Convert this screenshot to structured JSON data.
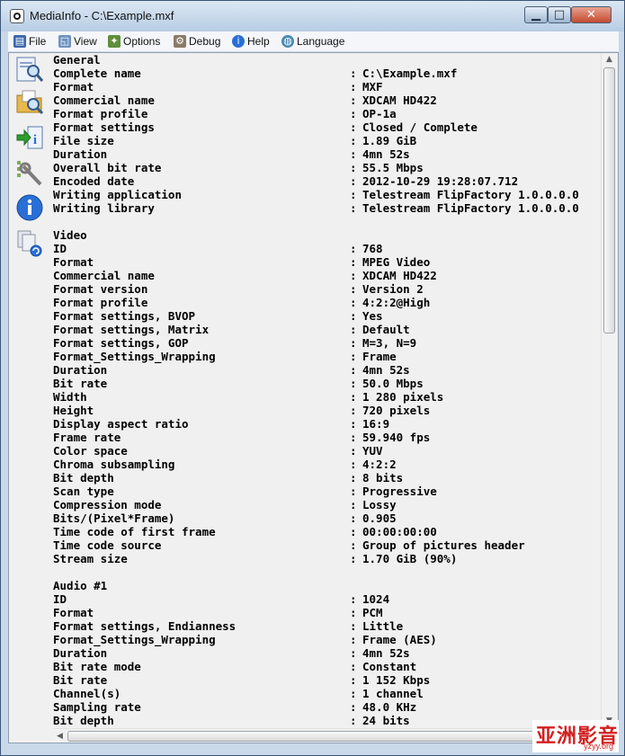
{
  "window": {
    "title": "MediaInfo - C:\\Example.mxf"
  },
  "title_buttons": {
    "minimize": "▁",
    "maximize": "□",
    "close": "✕"
  },
  "menu": [
    {
      "label": "File",
      "icon": "file-icon"
    },
    {
      "label": "View",
      "icon": "view-icon"
    },
    {
      "label": "Options",
      "icon": "options-icon"
    },
    {
      "label": "Debug",
      "icon": "debug-icon"
    },
    {
      "label": "Help",
      "icon": "help-icon"
    },
    {
      "label": "Language",
      "icon": "language-icon"
    }
  ],
  "sidebar_icons": [
    "open-file-icon",
    "open-folder-icon",
    "export-icon",
    "preferences-icon",
    "about-icon",
    "check-updates-icon"
  ],
  "colors": {
    "help_icon_blue": "#2a6fd6",
    "export_arrow_green": "#2e9e2e",
    "watermark_red": "#d22020"
  },
  "sections": [
    {
      "title": "General",
      "rows": [
        {
          "label": "Complete name",
          "value": "C:\\Example.mxf"
        },
        {
          "label": "Format",
          "value": "MXF"
        },
        {
          "label": "Commercial name",
          "value": "XDCAM HD422"
        },
        {
          "label": "Format profile",
          "value": "OP-1a"
        },
        {
          "label": "Format settings",
          "value": "Closed / Complete"
        },
        {
          "label": "File size",
          "value": "1.89 GiB"
        },
        {
          "label": "Duration",
          "value": "4mn 52s"
        },
        {
          "label": "Overall bit rate",
          "value": "55.5 Mbps"
        },
        {
          "label": "Encoded date",
          "value": "2012-10-29 19:28:07.712"
        },
        {
          "label": "Writing application",
          "value": "Telestream FlipFactory 1.0.0.0.0"
        },
        {
          "label": "Writing library",
          "value": "Telestream FlipFactory 1.0.0.0.0"
        }
      ]
    },
    {
      "title": "Video",
      "rows": [
        {
          "label": "ID",
          "value": "768"
        },
        {
          "label": "Format",
          "value": "MPEG Video"
        },
        {
          "label": "Commercial name",
          "value": "XDCAM HD422"
        },
        {
          "label": "Format version",
          "value": "Version 2"
        },
        {
          "label": "Format profile",
          "value": "4:2:2@High"
        },
        {
          "label": "Format settings, BVOP",
          "value": "Yes"
        },
        {
          "label": "Format settings, Matrix",
          "value": "Default"
        },
        {
          "label": "Format settings, GOP",
          "value": "M=3, N=9"
        },
        {
          "label": "Format_Settings_Wrapping",
          "value": "Frame"
        },
        {
          "label": "Duration",
          "value": "4mn 52s"
        },
        {
          "label": "Bit rate",
          "value": "50.0 Mbps"
        },
        {
          "label": "Width",
          "value": "1 280 pixels"
        },
        {
          "label": "Height",
          "value": "720 pixels"
        },
        {
          "label": "Display aspect ratio",
          "value": "16:9"
        },
        {
          "label": "Frame rate",
          "value": "59.940 fps"
        },
        {
          "label": "Color space",
          "value": "YUV"
        },
        {
          "label": "Chroma subsampling",
          "value": "4:2:2"
        },
        {
          "label": "Bit depth",
          "value": "8 bits"
        },
        {
          "label": "Scan type",
          "value": "Progressive"
        },
        {
          "label": "Compression mode",
          "value": "Lossy"
        },
        {
          "label": "Bits/(Pixel*Frame)",
          "value": "0.905"
        },
        {
          "label": "Time code of first frame",
          "value": "00:00:00:00"
        },
        {
          "label": "Time code source",
          "value": "Group of pictures header"
        },
        {
          "label": "Stream size",
          "value": "1.70 GiB (90%)"
        }
      ]
    },
    {
      "title": "Audio #1",
      "rows": [
        {
          "label": "ID",
          "value": "1024"
        },
        {
          "label": "Format",
          "value": "PCM"
        },
        {
          "label": "Format settings, Endianness",
          "value": "Little"
        },
        {
          "label": "Format_Settings_Wrapping",
          "value": "Frame (AES)"
        },
        {
          "label": "Duration",
          "value": "4mn 52s"
        },
        {
          "label": "Bit rate mode",
          "value": "Constant"
        },
        {
          "label": "Bit rate",
          "value": "1 152 Kbps"
        },
        {
          "label": "Channel(s)",
          "value": "1 channel"
        },
        {
          "label": "Sampling rate",
          "value": "48.0 KHz"
        },
        {
          "label": "Bit depth",
          "value": "24 bits"
        }
      ]
    }
  ],
  "separator": ":",
  "watermark": {
    "main": "亚洲影音",
    "sub": "yzyy.org"
  }
}
